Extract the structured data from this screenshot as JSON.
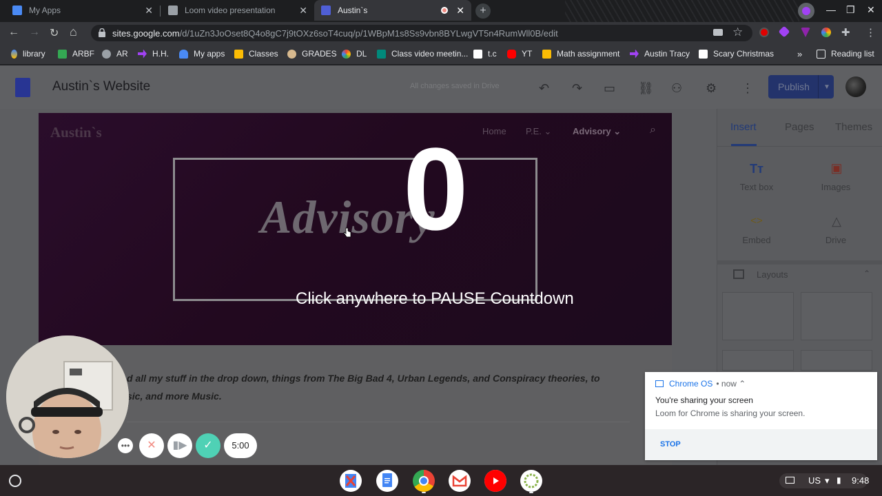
{
  "browser": {
    "tabs": [
      {
        "title": "My Apps",
        "active": false
      },
      {
        "title": "Loom video presentation",
        "active": false
      },
      {
        "title": "Austin`s",
        "active": true
      }
    ],
    "new_tab": "+",
    "url_host": "sites.google.com",
    "url_path": "/d/1uZn3JoOset8Q4o8gC7j9tOXz6soT4cuq/p/1WBpM1s8Ss9vbn8BYLwgVT5n4RumWll0B/edit",
    "bookmarks": [
      "library",
      "ARBF",
      "AR",
      "H.H.",
      "My apps",
      "Classes",
      "GRADES",
      "DL",
      "Class video meetin...",
      "t.c",
      "YT",
      "Math assignment",
      "Austin Tracy",
      "Scary Christmas"
    ],
    "bookmarks_overflow": "»",
    "reading_list": "Reading list"
  },
  "sites": {
    "site_title": "Austin`s Website",
    "saved_status": "All changes saved in Drive",
    "publish_label": "Publish",
    "canvas": {
      "site_name": "Austin`s",
      "nav": [
        "Home",
        "P.E.",
        "Advisory"
      ],
      "hero_word": "Advisory"
    },
    "body_text_line1": "d all my stuff in the drop down, things from The Big Bad 4, Urban Legends, and Conspiracy theories, to",
    "body_text_line2": "sic, and more Music.",
    "panel": {
      "tabs": [
        "Insert",
        "Pages",
        "Themes"
      ],
      "items": [
        {
          "label": "Text box",
          "icon": "text-box-icon"
        },
        {
          "label": "Images",
          "icon": "images-icon"
        },
        {
          "label": "Embed",
          "icon": "embed-icon"
        },
        {
          "label": "Drive",
          "icon": "drive-icon"
        }
      ],
      "layouts_label": "Layouts"
    }
  },
  "loom": {
    "countdown": "0",
    "pause_message": "Click anywhere to PAUSE Countdown",
    "timer": "5:00"
  },
  "notification": {
    "app": "Chrome OS",
    "time": "now",
    "title": "You're sharing your screen",
    "message": "Loom for Chrome is sharing your screen.",
    "action": "STOP"
  },
  "shelf": {
    "ime": "US",
    "time": "9:48"
  },
  "colors": {
    "publish": "#23336b",
    "canvas": "#2a0d2b",
    "loom_check": "#4fd1b5",
    "stop_link": "#1a73e8"
  }
}
